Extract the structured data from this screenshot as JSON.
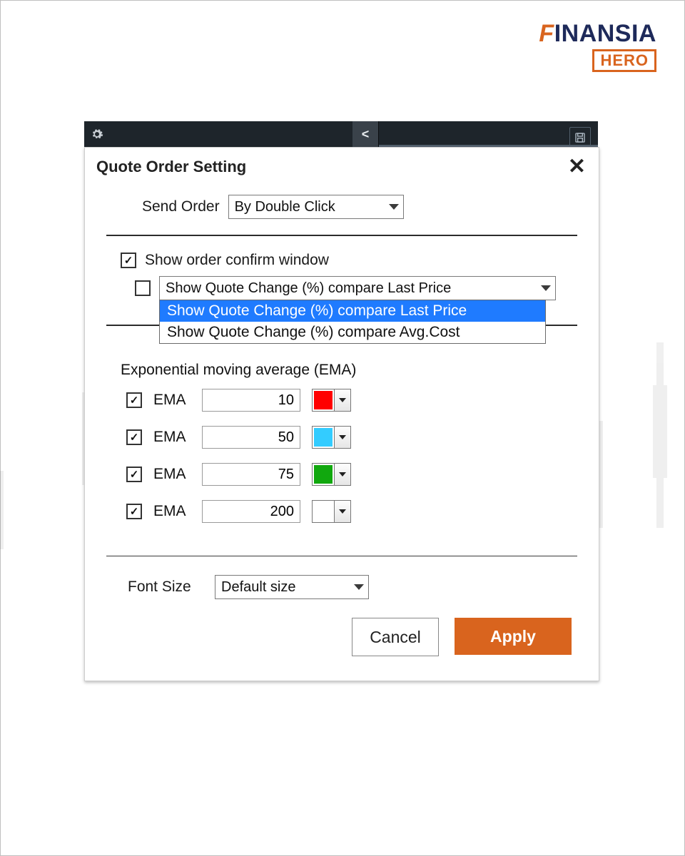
{
  "brand": {
    "name_prefix": "F",
    "name_rest": "INANSIA",
    "hero": "HERO"
  },
  "toolbar": {
    "lt_symbol": "<"
  },
  "dialog": {
    "title": "Quote Order Setting"
  },
  "send_order": {
    "label": "Send Order",
    "value": "By Double Click"
  },
  "show_confirm": {
    "checked": true,
    "label": "Show order confirm window"
  },
  "quote_change": {
    "checked": false,
    "value": "Show Quote Change (%) compare Last Price",
    "options": [
      "Show Quote Change (%) compare Last Price",
      "Show Quote Change (%) compare Avg.Cost"
    ],
    "highlight_index": 0
  },
  "ema": {
    "heading": "Exponential moving average (EMA)",
    "rows": [
      {
        "checked": true,
        "label": "EMA",
        "value": "10",
        "color": "#ff0000"
      },
      {
        "checked": true,
        "label": "EMA",
        "value": "50",
        "color": "#33ccff"
      },
      {
        "checked": true,
        "label": "EMA",
        "value": "75",
        "color": "#11a80e"
      },
      {
        "checked": true,
        "label": "EMA",
        "value": "200",
        "color": "#ffffff"
      }
    ]
  },
  "font_size": {
    "label": "Font Size",
    "value": "Default size"
  },
  "buttons": {
    "cancel": "Cancel",
    "apply": "Apply"
  }
}
